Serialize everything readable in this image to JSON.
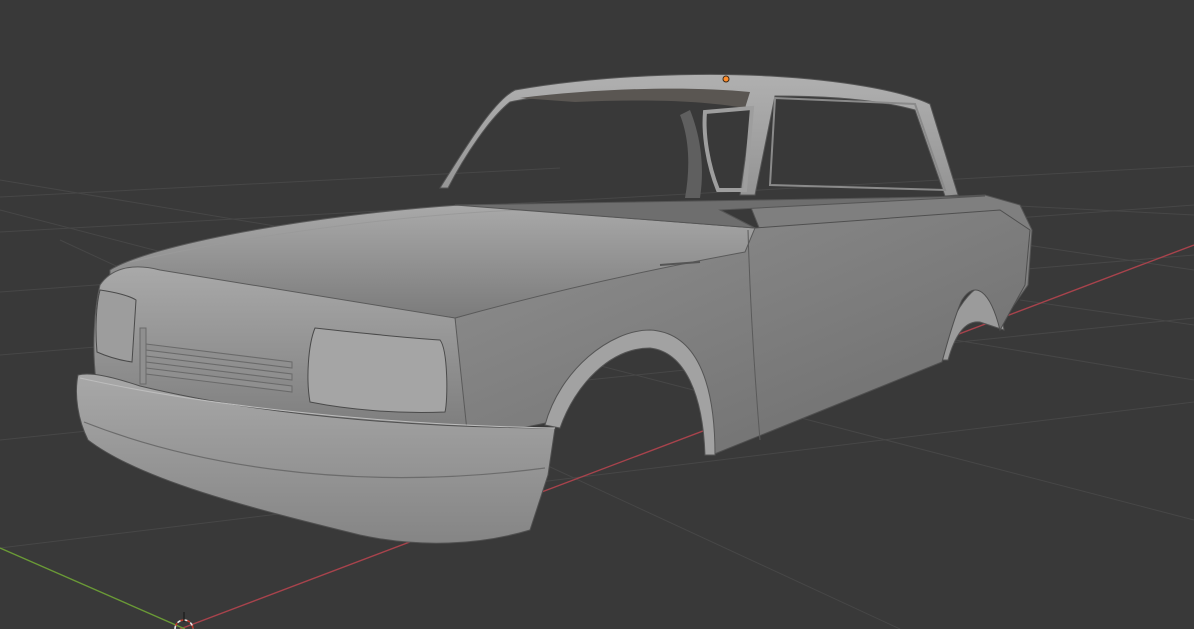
{
  "viewport": {
    "mode": "solid",
    "colors": {
      "background": "#393939",
      "grid_line": "#4a4a4a",
      "axis_x": "#b0454e",
      "axis_y": "#6e9a3a",
      "model_base": "#8e8e8e",
      "model_light": "#a7a7a7",
      "model_dark": "#6e6e6e",
      "origin_point": "#ff8c2a"
    },
    "object": {
      "name": "car-body-shell"
    },
    "icons": [
      "3d-cursor-icon",
      "object-origin-icon"
    ]
  }
}
